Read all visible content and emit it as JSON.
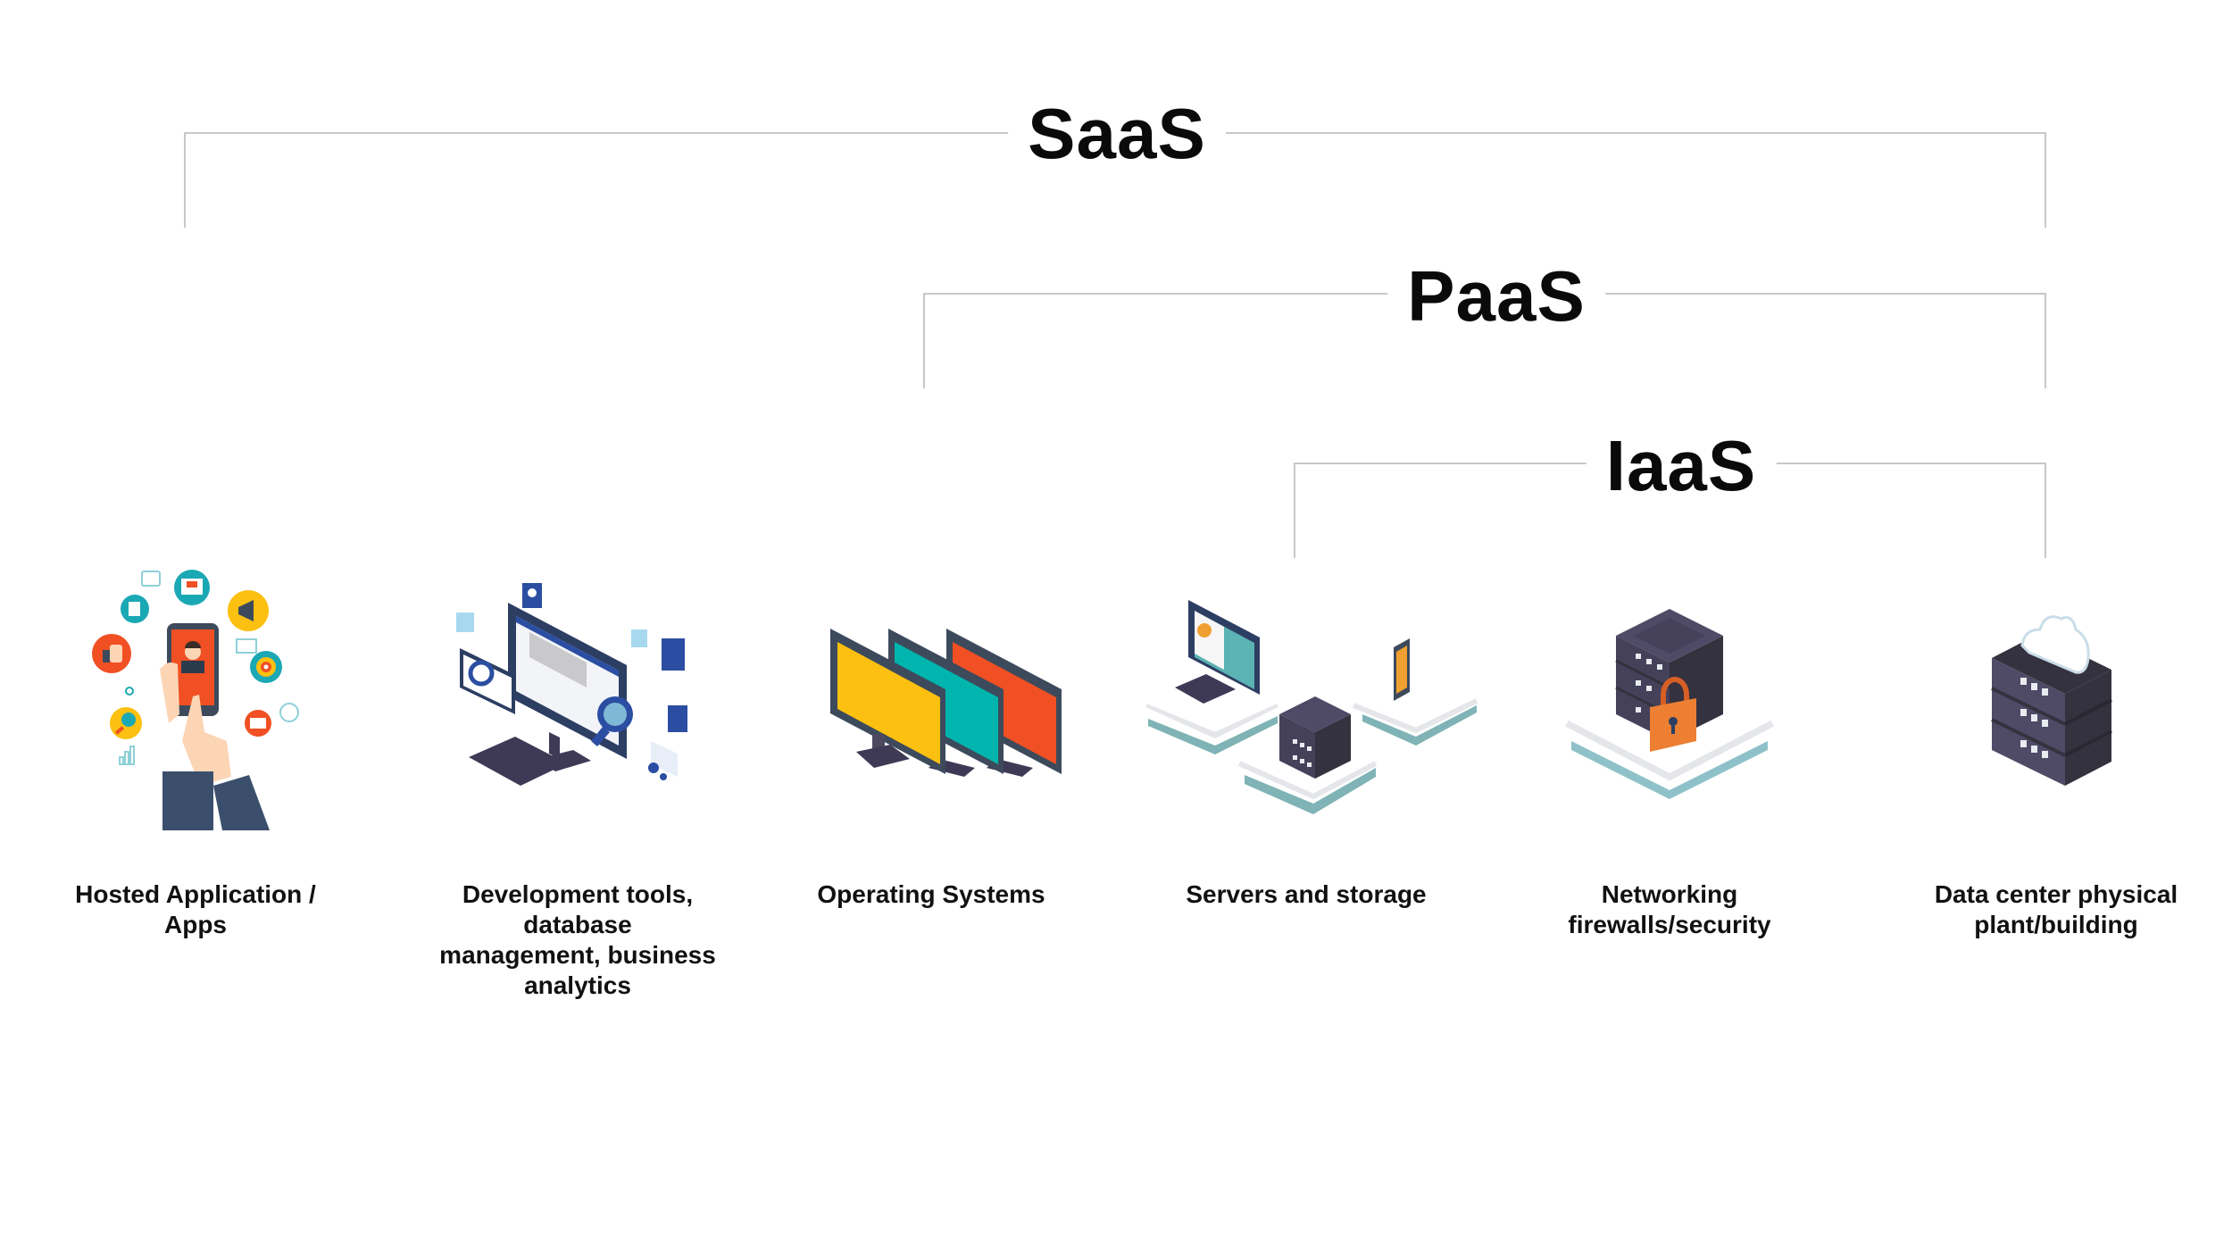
{
  "tiers": [
    {
      "id": "saas",
      "label": "SaaS",
      "covers": [
        "Hosted Application / Apps",
        "Development tools, database management, business analytics",
        "Operating Systems",
        "Servers and storage",
        "Networking firewalls/security",
        "Data center physical plant/building"
      ]
    },
    {
      "id": "paas",
      "label": "PaaS",
      "covers": [
        "Operating Systems",
        "Servers and storage",
        "Networking firewalls/security",
        "Data center physical plant/building"
      ]
    },
    {
      "id": "iaas",
      "label": "IaaS",
      "covers": [
        "Servers and storage",
        "Networking firewalls/security",
        "Data center physical plant/building"
      ]
    }
  ],
  "layers": [
    {
      "id": "apps",
      "icon": "smartphone-apps-icon",
      "lines": [
        "Hosted Application /",
        "Apps"
      ]
    },
    {
      "id": "devtools",
      "icon": "developer-workstation-icon",
      "lines": [
        "Development tools,",
        "database",
        "management, business",
        "analytics"
      ]
    },
    {
      "id": "os",
      "icon": "monitors-icon",
      "lines": [
        "Operating Systems"
      ]
    },
    {
      "id": "servers",
      "icon": "servers-storage-icon",
      "lines": [
        "Servers and storage"
      ]
    },
    {
      "id": "network",
      "icon": "locked-server-icon",
      "lines": [
        "Networking",
        "firewalls/security"
      ]
    },
    {
      "id": "datacenter",
      "icon": "cloud-server-icon",
      "lines": [
        "Data center physical",
        "plant/building"
      ]
    }
  ],
  "colors": {
    "bracket": "#c8c8c8",
    "orange": "#f05023",
    "yellow": "#fcc010",
    "teal": "#00b5ad",
    "navy": "#3d4a5c",
    "server": "#4f4a66"
  }
}
